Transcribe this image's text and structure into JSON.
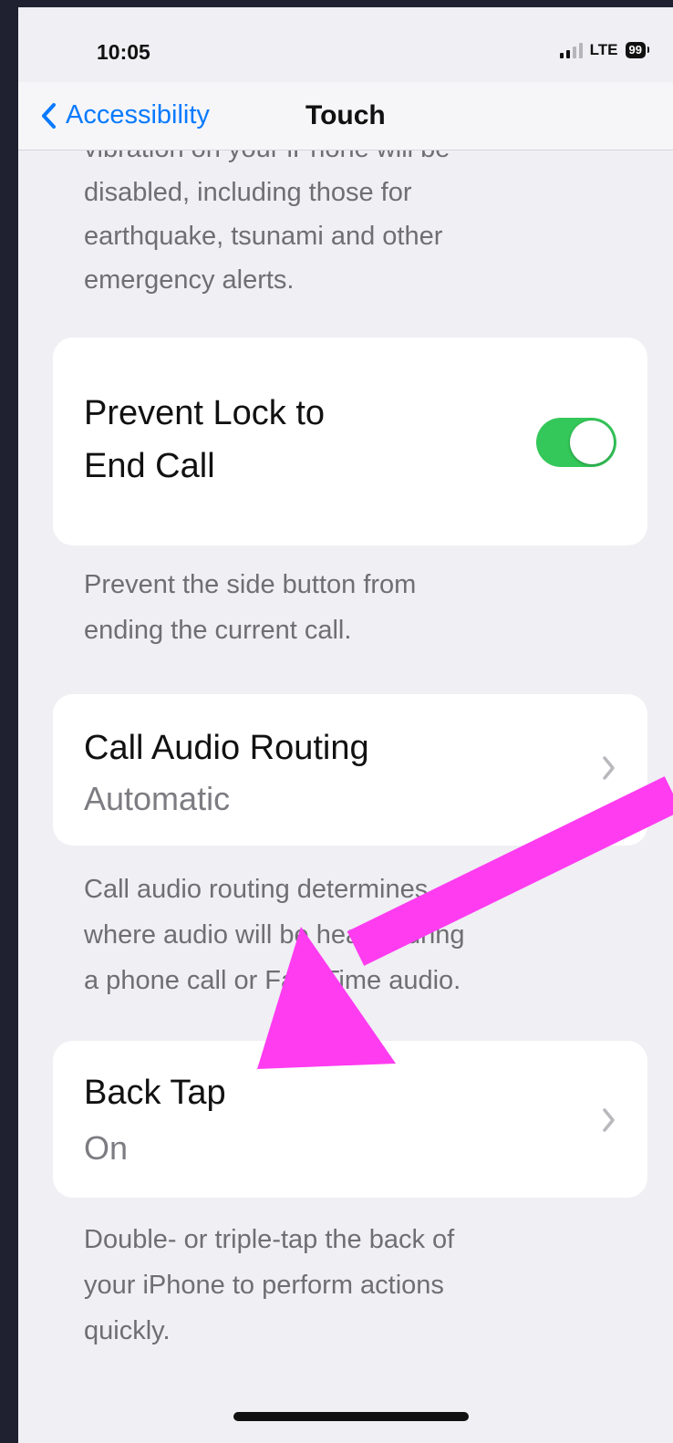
{
  "status_bar": {
    "time": "10:05",
    "network": "LTE",
    "battery": "99"
  },
  "nav": {
    "back_label": "Accessibility",
    "title": "Touch"
  },
  "sections": {
    "emergency_footer": {
      "cut_line": "vibration on your iPhone will be",
      "lines": [
        "disabled, including those for",
        "earthquake, tsunami and other",
        "emergency alerts."
      ]
    },
    "prevent_lock": {
      "title_lines": [
        "Prevent Lock to",
        "End Call"
      ],
      "toggle_on": true,
      "footer_lines": [
        "Prevent the side button from",
        "ending the current call."
      ]
    },
    "call_audio": {
      "title": "Call Audio Routing",
      "value": "Automatic",
      "footer_lines": [
        "Call audio routing determines",
        "where audio will be heard during",
        "a phone call or FaceTime audio."
      ]
    },
    "back_tap": {
      "title": "Back Tap",
      "value": "On",
      "footer_lines": [
        "Double- or triple-tap the back of",
        "your iPhone to perform actions",
        "quickly."
      ]
    }
  },
  "colors": {
    "accent": "#0a7aff",
    "toggle_on": "#34c759",
    "annotation_arrow": "#ff3cf0"
  },
  "icons": {
    "back": "chevron-left-icon",
    "disclosure": "chevron-right-icon"
  }
}
